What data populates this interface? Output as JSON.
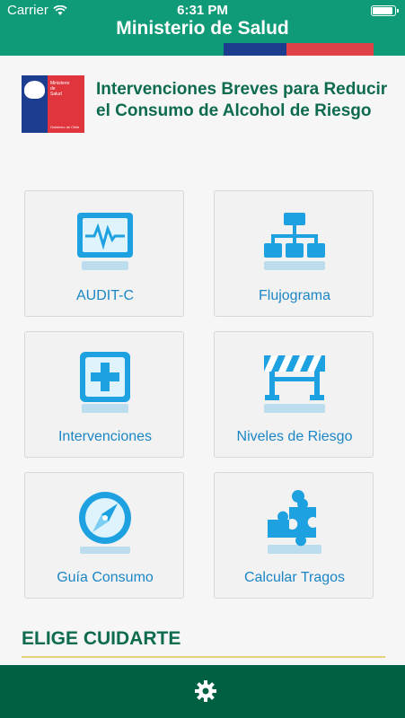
{
  "status_bar": {
    "carrier": "Carrier",
    "time": "6:31 PM",
    "battery_level": 1.0
  },
  "header": {
    "title": "Ministerio de Salud"
  },
  "ministry": {
    "logo_lines": [
      "Ministerio",
      "de",
      "Salud"
    ],
    "logo_footer": "Gobierno de Chile",
    "heading": "Intervenciones Breves para Reducir el Consumo de Alcohol de Riesgo"
  },
  "menu": [
    {
      "label": "AUDIT-C",
      "icon": "monitor-pulse-icon"
    },
    {
      "label": "Flujograma",
      "icon": "flowchart-icon"
    },
    {
      "label": "Intervenciones",
      "icon": "plus-icon"
    },
    {
      "label": "Niveles de Riesgo",
      "icon": "barrier-icon"
    },
    {
      "label": "Guía Consumo",
      "icon": "compass-icon"
    },
    {
      "label": "Calcular Tragos",
      "icon": "puzzle-icon"
    }
  ],
  "section": {
    "title": "ELIGE CUIDARTE"
  },
  "colors": {
    "header": "#0f9a78",
    "accent": "#1b86c6",
    "heading": "#0e6b4f",
    "footer": "#006044"
  }
}
